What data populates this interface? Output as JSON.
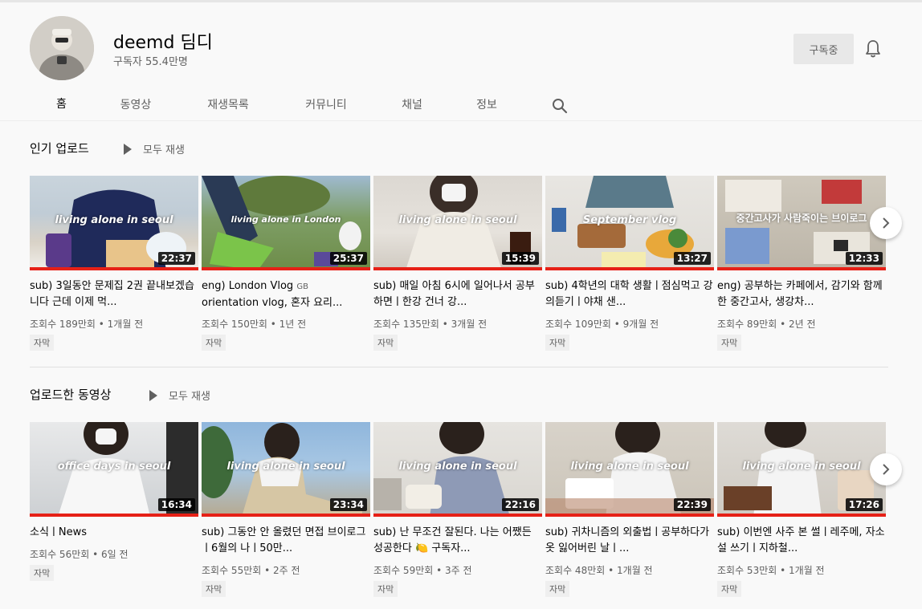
{
  "channel": {
    "name": "deemd 딤디",
    "subscribers": "구독자 55.4만명",
    "subscribe_label": "구독중"
  },
  "tabs": [
    "홈",
    "동영상",
    "재생목록",
    "커뮤니티",
    "채널",
    "정보"
  ],
  "sections": [
    {
      "title": "인기 업로드",
      "play_all": "모두 재생",
      "videos": [
        {
          "title": "sub) 3일동안 문제집 2권 끝내보겠습니다 근데 이제 먹...",
          "views": "조회수 189만회",
          "age": "1개월 전",
          "tag": "자막",
          "duration": "22:37",
          "overlay": "living alone in seoul"
        },
        {
          "title": "eng) London Vlog",
          "title_suffix": "GB",
          "title_rest": "orientation vlog, 혼자 요리...",
          "views": "조회수 150만회",
          "age": "1년 전",
          "tag": "자막",
          "duration": "25:37",
          "overlay": "living alone in London"
        },
        {
          "title": "sub) 매일 아침 6시에 일어나서 공부하면ㅣ한강 건너 강...",
          "views": "조회수 135만회",
          "age": "3개월 전",
          "tag": "자막",
          "duration": "15:39",
          "overlay": "living alone in seoul"
        },
        {
          "title": "sub) 4학년의 대학 생활ㅣ점심먹고 강의듣기ㅣ야채 샌...",
          "views": "조회수 109만회",
          "age": "9개월 전",
          "tag": "자막",
          "duration": "13:27",
          "overlay": "September vlog"
        },
        {
          "title": "eng) 공부하는 카페에서, 감기와 함께한 중간고사, 생강차...",
          "views": "조회수 89만회",
          "age": "2년 전",
          "tag": "자막",
          "duration": "12:33",
          "overlay": "중간고사가 사람죽이는 브이로그"
        }
      ]
    },
    {
      "title": "업로드한 동영상",
      "play_all": "모두 재생",
      "videos": [
        {
          "title": "소식ㅣNews",
          "views": "조회수 56만회",
          "age": "6일 전",
          "tag": "자막",
          "duration": "16:34",
          "overlay": "office days in seoul"
        },
        {
          "title": "sub) 그동안 안 올렸던 면접 브이로그ㅣ6월의 나ㅣ50만...",
          "views": "조회수 55만회",
          "age": "2주 전",
          "tag": "자막",
          "duration": "23:34",
          "overlay": "living alone in seoul"
        },
        {
          "title": "sub) 난 무조건 잘된다. 나는 어쨌든 성공한다 🍋 구독자...",
          "views": "조회수 59만회",
          "age": "3주 전",
          "tag": "자막",
          "duration": "22:16",
          "overlay": "living alone in seoul"
        },
        {
          "title": "sub) 귀차니즘의 외출법ㅣ공부하다가 옷 잃어버린 날ㅣ...",
          "views": "조회수 48만회",
          "age": "1개월 전",
          "tag": "자막",
          "duration": "22:39",
          "overlay": "living alone in seoul"
        },
        {
          "title": "sub) 이번엔 사주 본 썰ㅣ레주메, 자소설 쓰기ㅣ지하철...",
          "views": "조회수 53만회",
          "age": "1개월 전",
          "tag": "자막",
          "duration": "17:26",
          "overlay": "living alone in seoul"
        }
      ]
    }
  ]
}
